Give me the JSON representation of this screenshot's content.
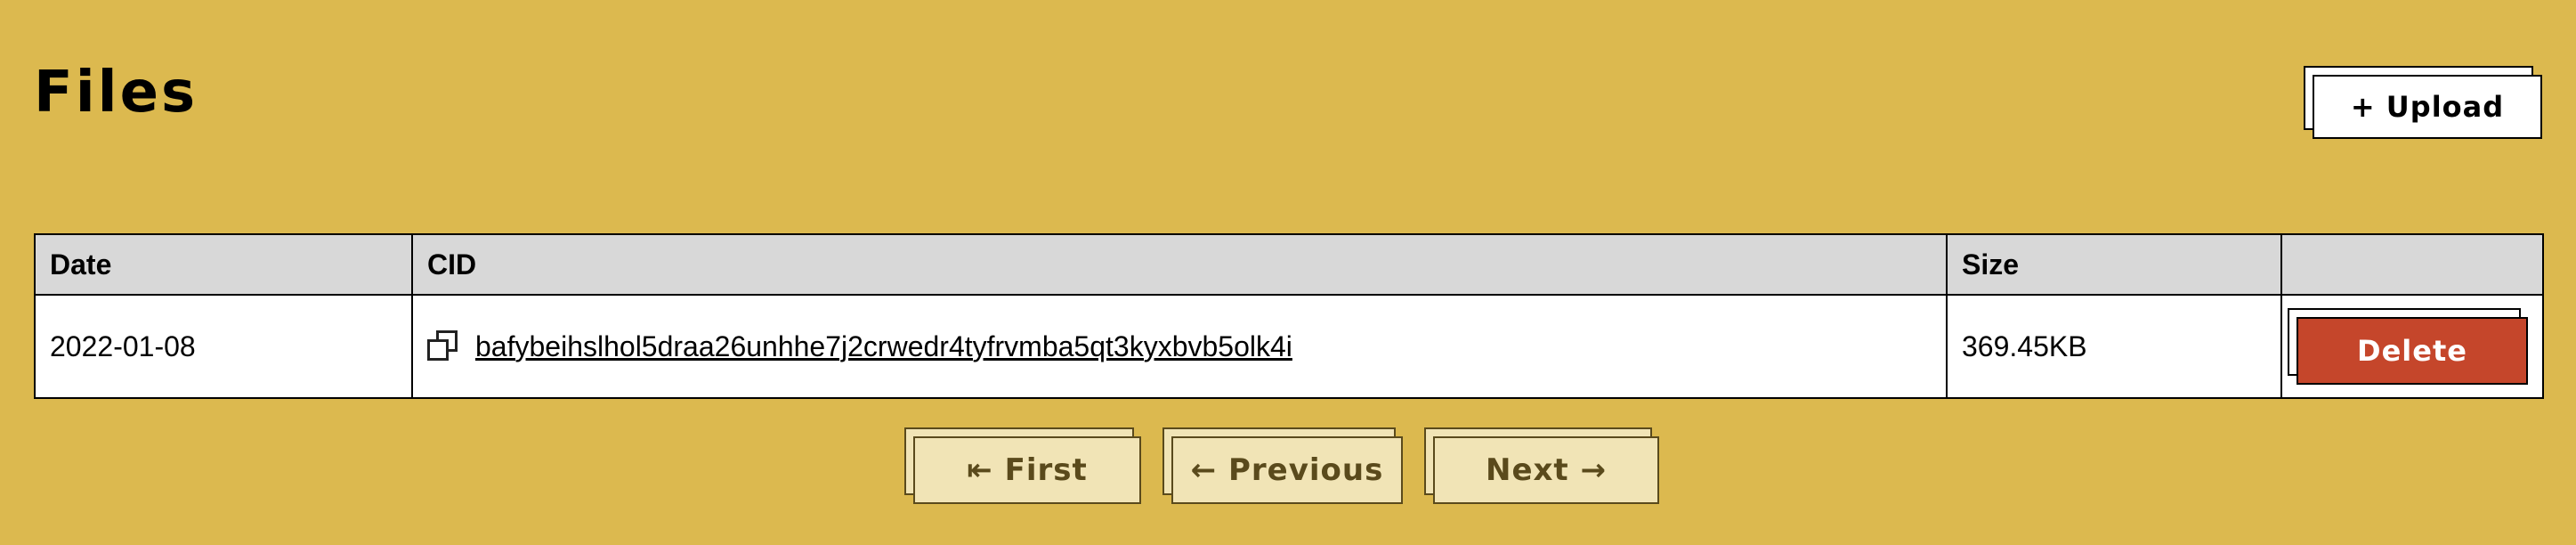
{
  "page": {
    "title": "Files"
  },
  "toolbar": {
    "upload_label": "+ Upload"
  },
  "table": {
    "headers": {
      "date": "Date",
      "cid": "CID",
      "size": "Size",
      "action": ""
    },
    "rows": [
      {
        "date": "2022-01-08",
        "cid": "bafybeihslhol5draa26unhhe7j2crwedr4tyfrvmba5qt3kyxbvb5olk4i",
        "size": "369.45KB",
        "delete_label": "Delete"
      }
    ]
  },
  "pagination": {
    "first_label": "⇤ First",
    "previous_label": "← Previous",
    "next_label": "Next →"
  },
  "colors": {
    "background": "#dcb94f",
    "delete_button": "#c5462b",
    "pager_button": "#f1e4b6",
    "header_row": "#d8d8d8"
  },
  "icons": {
    "copy": "copy-icon"
  }
}
